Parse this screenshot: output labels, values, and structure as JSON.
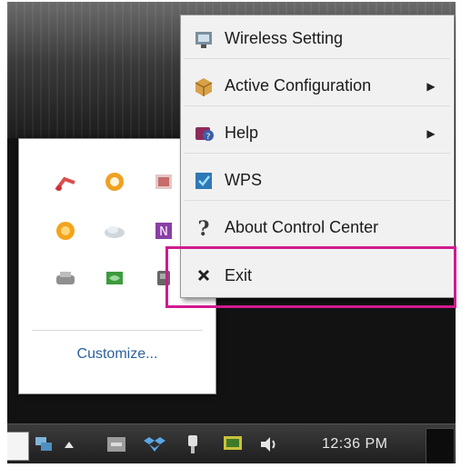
{
  "context_menu": {
    "items": [
      {
        "label": "Wireless Setting",
        "icon": "wireless-setting-icon",
        "submenu": false
      },
      {
        "label": "Active Configuration",
        "icon": "configuration-box-icon",
        "submenu": true
      },
      {
        "label": "Help",
        "icon": "help-book-icon",
        "submenu": true
      },
      {
        "label": "WPS",
        "icon": "wps-icon",
        "submenu": false
      },
      {
        "label": "About Control Center",
        "icon": "question-mark-icon",
        "submenu": false
      },
      {
        "label": "Exit",
        "icon": "close-x-icon",
        "submenu": false
      }
    ]
  },
  "tray_flyout": {
    "customize_label": "Customize...",
    "icons": [
      "network-red-icon",
      "orange-gear-icon",
      "app-tile-icon",
      "orange-circle-icon",
      "white-cloud-icon",
      "onenote-icon",
      "printer-icon",
      "nvidia-icon",
      "device-icon"
    ]
  },
  "taskbar": {
    "clock": "12:36 PM",
    "icons": [
      "network-icon",
      "show-hidden-arrow-icon",
      "app-window-icon",
      "dropbox-icon",
      "safely-remove-icon",
      "display-icon",
      "volume-icon"
    ]
  },
  "colors": {
    "highlight": "#d11a8f",
    "link": "#2c5f9e"
  }
}
